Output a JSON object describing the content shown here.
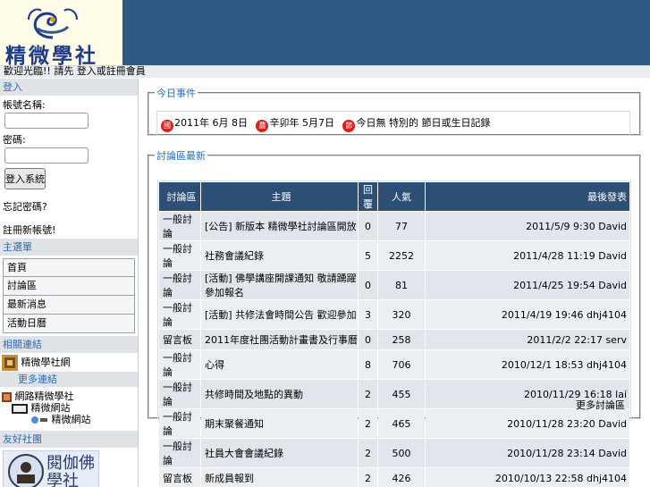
{
  "header": {
    "logo_text": "精微學社",
    "welcome": "歡迎光臨!! 請先 登入或註冊會員"
  },
  "login": {
    "section_title": "登入",
    "username_label": "帳號名稱:",
    "password_label": "密碼:",
    "login_button": "登入系統",
    "forgot_password": "忘記密碼?",
    "register": "註冊新帳號!"
  },
  "menu": {
    "section_title": "主選單",
    "items": [
      "首頁",
      "討論區",
      "最新消息",
      "活動日曆"
    ]
  },
  "links": {
    "section_title": "相關連結",
    "item1": "精微學社網",
    "item2": "更多連結",
    "item3": "網路精微學社",
    "item4": "精微網站"
  },
  "partners": {
    "section_title": "友好社團",
    "banner_text": "閱伽佛學社"
  },
  "events": {
    "legend": "今日事件",
    "badge1": "國",
    "date": "2011年 6月 8日",
    "badge2": "農",
    "lunar": "辛卯年 5月7日",
    "badge3": "節",
    "note": "今日無 特別的 節日或生日記錄"
  },
  "forum": {
    "legend": "討論區最新",
    "columns": [
      "討論區",
      "主題",
      "回覆",
      "人氣",
      "最後發表"
    ],
    "rows": [
      {
        "cat": "一般討論",
        "title": "[公告] 新版本 精微學社討論區開放",
        "replies": "0",
        "views": "77",
        "last": "2011/5/9 9:30 David"
      },
      {
        "cat": "一般討論",
        "title": "社務會議紀錄",
        "replies": "5",
        "views": "2252",
        "last": "2011/4/28 11:19 David"
      },
      {
        "cat": "一般討論",
        "title": "[活動] 佛學講座開課通知 敬請踴躍參加報名",
        "replies": "0",
        "views": "81",
        "last": "2011/4/25 19:54 David"
      },
      {
        "cat": "一般討論",
        "title": "[活動] 共修法會時間公告 歡迎參加",
        "replies": "3",
        "views": "320",
        "last": "2011/4/19 19:46 dhj4104"
      },
      {
        "cat": "留言板",
        "title": "2011年度社團活動計畫書及行事曆",
        "replies": "0",
        "views": "258",
        "last": "2011/2/2 22:17 serv"
      },
      {
        "cat": "一般討論",
        "title": "心得",
        "replies": "8",
        "views": "706",
        "last": "2010/12/1 18:53 dhj4104"
      },
      {
        "cat": "一般討論",
        "title": "共修時間及地點的異動",
        "replies": "2",
        "views": "455",
        "last": "2010/11/29 16:18 lai"
      },
      {
        "cat": "一般討論",
        "title": "期末聚餐通知",
        "replies": "2",
        "views": "465",
        "last": "2010/11/28 23:20 David"
      },
      {
        "cat": "一般討論",
        "title": "社員大會會議紀錄",
        "replies": "2",
        "views": "500",
        "last": "2010/11/28 23:14 David"
      },
      {
        "cat": "留言板",
        "title": "新成員報到",
        "replies": "2",
        "views": "426",
        "last": "2010/10/13 22:58 dhj4104"
      }
    ],
    "more": "更多討論區"
  },
  "colors": {
    "header_bg": "#2f5a86",
    "table_header": "#2d4e75",
    "accent_text": "#2a6bb3",
    "badge_red": "#d52121"
  }
}
